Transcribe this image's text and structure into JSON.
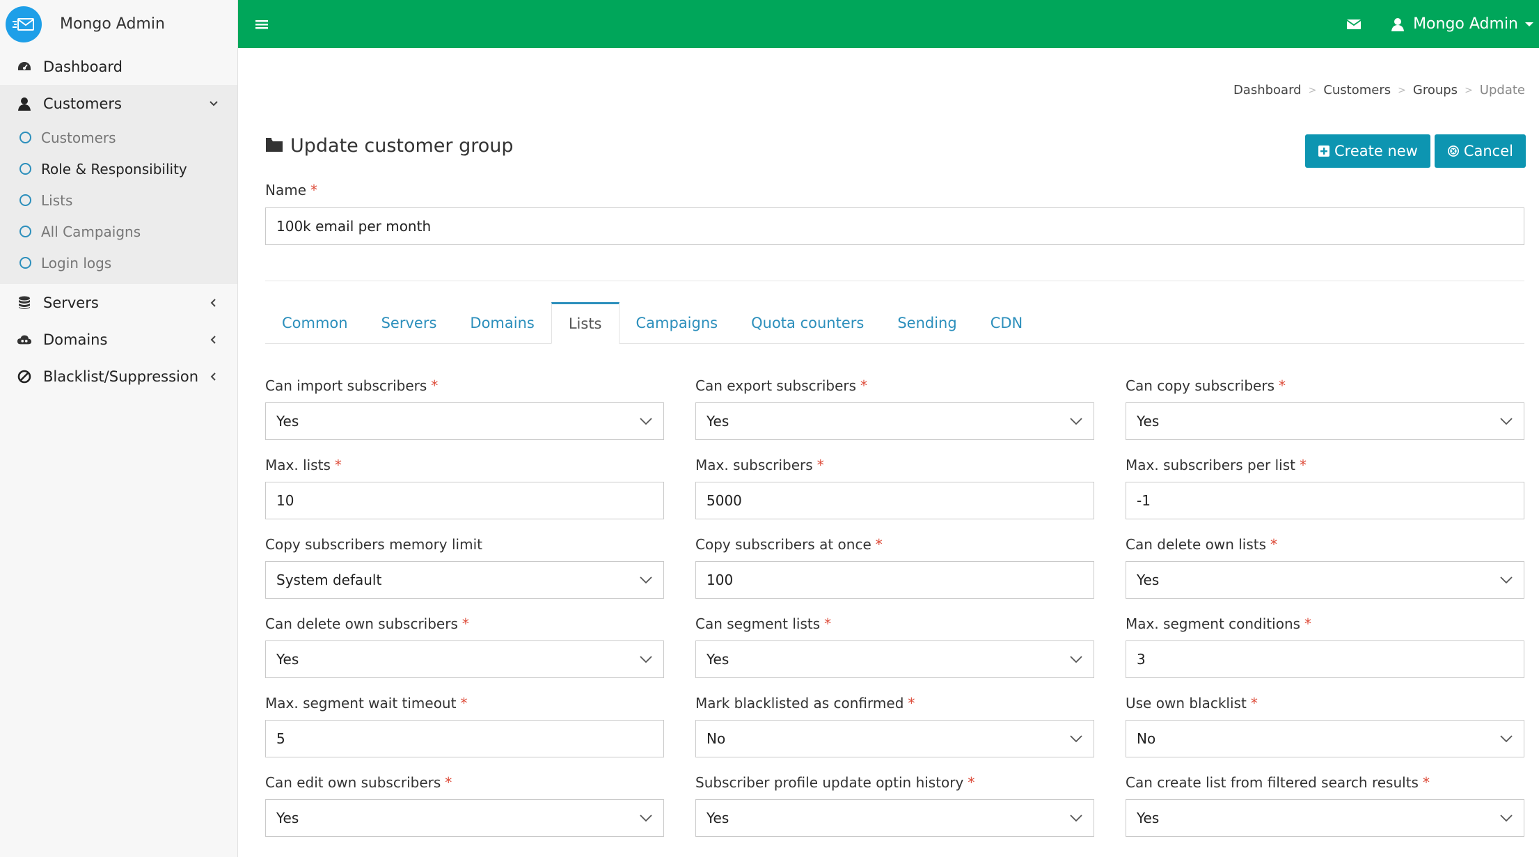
{
  "brand": {
    "name": "Mongo Admin"
  },
  "sidebar": {
    "items": [
      {
        "label": "Dashboard",
        "icon": "dashboard-icon"
      },
      {
        "label": "Customers",
        "icon": "user-icon",
        "open": true,
        "children": [
          {
            "label": "Customers"
          },
          {
            "label": "Role & Responsibility",
            "active": true
          },
          {
            "label": "Lists"
          },
          {
            "label": "All Campaigns"
          },
          {
            "label": "Login logs"
          }
        ]
      },
      {
        "label": "Servers",
        "icon": "database-icon"
      },
      {
        "label": "Domains",
        "icon": "cloud-icon"
      },
      {
        "label": "Blacklist/Suppression",
        "icon": "ban-icon"
      }
    ]
  },
  "topbar": {
    "user": "Mongo Admin",
    "color": "#00a65a"
  },
  "breadcrumb": [
    "Dashboard",
    "Customers",
    "Groups",
    "Update"
  ],
  "page": {
    "title": "Update customer group",
    "create_label": "Create new",
    "cancel_label": "Cancel",
    "name_label": "Name",
    "name_value": "100k email per month"
  },
  "tabs": [
    "Common",
    "Servers",
    "Domains",
    "Lists",
    "Campaigns",
    "Quota counters",
    "Sending",
    "CDN"
  ],
  "active_tab": "Lists",
  "fields": [
    {
      "label": "Can import subscribers",
      "value": "Yes",
      "type": "select",
      "required": true
    },
    {
      "label": "Can export subscribers",
      "value": "Yes",
      "type": "select",
      "required": true
    },
    {
      "label": "Can copy subscribers",
      "value": "Yes",
      "type": "select",
      "required": true
    },
    {
      "label": "Max. lists",
      "value": "10",
      "type": "text",
      "required": true
    },
    {
      "label": "Max. subscribers",
      "value": "5000",
      "type": "text",
      "required": true
    },
    {
      "label": "Max. subscribers per list",
      "value": "-1",
      "type": "text",
      "required": true
    },
    {
      "label": "Copy subscribers memory limit",
      "value": "System default",
      "type": "select",
      "required": false
    },
    {
      "label": "Copy subscribers at once",
      "value": "100",
      "type": "text",
      "required": true
    },
    {
      "label": "Can delete own lists",
      "value": "Yes",
      "type": "select",
      "required": true
    },
    {
      "label": "Can delete own subscribers",
      "value": "Yes",
      "type": "select",
      "required": true
    },
    {
      "label": "Can segment lists",
      "value": "Yes",
      "type": "select",
      "required": true
    },
    {
      "label": "Max. segment conditions",
      "value": "3",
      "type": "text",
      "required": true
    },
    {
      "label": "Max. segment wait timeout",
      "value": "5",
      "type": "text",
      "required": true
    },
    {
      "label": "Mark blacklisted as confirmed",
      "value": "No",
      "type": "select",
      "required": true
    },
    {
      "label": "Use own blacklist",
      "value": "No",
      "type": "select",
      "required": true
    },
    {
      "label": "Can edit own subscribers",
      "value": "Yes",
      "type": "select",
      "required": true
    },
    {
      "label": "Subscriber profile update optin history",
      "value": "Yes",
      "type": "select",
      "required": true
    },
    {
      "label": "Can create list from filtered search results",
      "value": "Yes",
      "type": "select",
      "required": true
    }
  ]
}
